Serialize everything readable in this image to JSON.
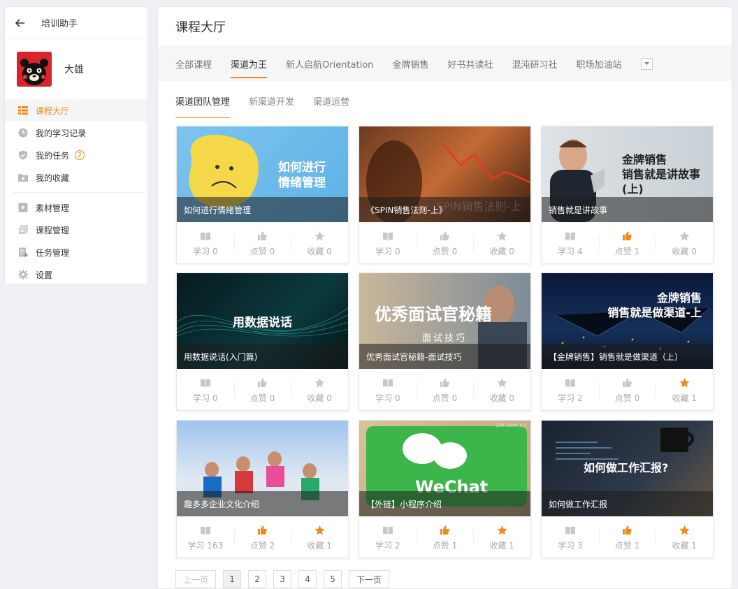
{
  "sidebar": {
    "title": "培训助手",
    "username": "大雄",
    "nav": [
      {
        "label": "课程大厅",
        "icon": "list-icon",
        "active": true
      },
      {
        "label": "我的学习记录",
        "icon": "clock-icon"
      },
      {
        "label": "我的任务",
        "icon": "shield-icon",
        "badge": "2"
      },
      {
        "label": "我的收藏",
        "icon": "folder-icon"
      }
    ],
    "nav2": [
      {
        "label": "素材管理",
        "icon": "media-icon"
      },
      {
        "label": "课程管理",
        "icon": "copy-icon"
      },
      {
        "label": "任务管理",
        "icon": "doc-icon"
      },
      {
        "label": "设置",
        "icon": "gear-icon"
      }
    ]
  },
  "main": {
    "title": "课程大厅",
    "tabs": [
      "全部课程",
      "渠道为王",
      "新人启航Orientation",
      "金牌销售",
      "好书共读社",
      "混沌研习社",
      "职场加油站"
    ],
    "active_tab": 1,
    "subtabs": [
      "渠道团队管理",
      "新渠道开发",
      "渠道运营"
    ],
    "active_subtab": 0
  },
  "stat_labels": {
    "study": "学习",
    "like": "点赞",
    "fav": "收藏"
  },
  "cards": [
    {
      "caption": "如何进行情绪管理",
      "overlay": "如何进行\n情绪管理",
      "study": "0",
      "like": "0",
      "fav": "0",
      "liked": false,
      "faved": false
    },
    {
      "caption": "《SPIN销售法则-上》",
      "overlay": "SPIN销售法则-上",
      "study": "0",
      "like": "0",
      "fav": "0",
      "liked": false,
      "faved": false
    },
    {
      "caption": "销售就是讲故事",
      "overlay": "金牌销售\n销售就是讲故事\n(上)",
      "study": "4",
      "like": "1",
      "fav": "0",
      "liked": true,
      "faved": false
    },
    {
      "caption": "用数据说话(入门篇)",
      "overlay": "用数据说话",
      "study": "0",
      "like": "0",
      "fav": "0",
      "liked": false,
      "faved": false
    },
    {
      "caption": "优秀面试官秘籍-面试技巧",
      "overlay": "优秀面试官秘籍",
      "overlay_sub": "面试技巧",
      "study": "0",
      "like": "0",
      "fav": "0",
      "liked": false,
      "faved": false
    },
    {
      "caption": "【金牌销售】销售就是做渠道（上）",
      "overlay": "金牌销售\n销售就是做渠道-上",
      "study": "2",
      "like": "0",
      "fav": "1",
      "liked": false,
      "faved": true
    },
    {
      "caption": "趣多多企业文化介绍",
      "overlay": "",
      "study": "163",
      "like": "2",
      "fav": "1",
      "liked": true,
      "faved": true
    },
    {
      "caption": "【外链】小程序介绍",
      "overlay": "WeChat",
      "watermark": "zol.com.cn",
      "study": "2",
      "like": "1",
      "fav": "1",
      "liked": true,
      "faved": true
    },
    {
      "caption": "如何做工作汇报",
      "overlay": "如何做工作汇报?",
      "study": "3",
      "like": "1",
      "fav": "1",
      "liked": true,
      "faved": true
    }
  ],
  "pager": {
    "prev": "上一页",
    "next": "下一页",
    "pages": [
      "1",
      "2",
      "3",
      "4",
      "5"
    ],
    "current": 0
  },
  "colors": {
    "accent": "#f08a1c",
    "muted": "#aaaaaa"
  }
}
